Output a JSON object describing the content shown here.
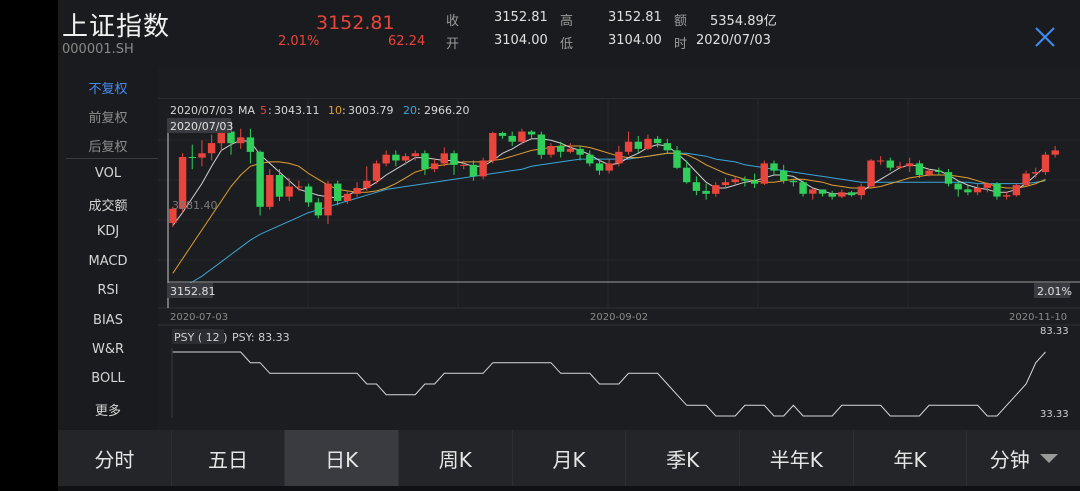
{
  "header": {
    "title": "上证指数",
    "code": "000001.SH",
    "price": "3152.81",
    "change_pct": "2.01%",
    "change": "62.24",
    "quotes": [
      {
        "label": "收",
        "value": "3152.81"
      },
      {
        "label": "高",
        "value": "3152.81"
      },
      {
        "label": "额",
        "value": "5354.89亿"
      },
      {
        "label": "开",
        "value": "3104.00"
      },
      {
        "label": "低",
        "value": "3104.00"
      },
      {
        "label": "时",
        "value": "2020/07/03"
      }
    ]
  },
  "sidebar": {
    "adjust": [
      "不复权",
      "前复权",
      "后复权"
    ],
    "indicators": [
      "VOL",
      "成交额",
      "KDJ",
      "MACD",
      "RSI",
      "BIAS",
      "W&R",
      "BOLL",
      "更多"
    ]
  },
  "chart_data": {
    "type": "candlestick",
    "ma_header": {
      "date": "2020/07/03",
      "label": "MA",
      "ma5_label": "5",
      "ma5": "3043.11",
      "ma10_label": "10",
      "ma10": "3003.79",
      "ma20_label": "20",
      "ma20": "2966.20"
    },
    "crosshair_date": "2020/07/03",
    "crosshair_price": "3152.81",
    "crosshair_pct": "2.01%",
    "mid_price_label": "3181.40",
    "x_labels": [
      "2020-07-03",
      "2020-09-02",
      "2020-11-10"
    ],
    "y_range": [
      2900,
      3460
    ],
    "colors": {
      "up": "#e8453c",
      "down": "#2fcf5a",
      "ma5": "#d0d0d0",
      "ma10": "#e0a030",
      "ma20": "#3aa7d8"
    },
    "candles": [
      [
        3104,
        3153,
        3090,
        3160
      ],
      [
        3153,
        3332,
        3140,
        3345
      ],
      [
        3332,
        3330,
        3290,
        3375
      ],
      [
        3330,
        3345,
        3300,
        3390
      ],
      [
        3345,
        3380,
        3320,
        3410
      ],
      [
        3380,
        3420,
        3350,
        3440
      ],
      [
        3420,
        3380,
        3340,
        3455
      ],
      [
        3380,
        3400,
        3360,
        3430
      ],
      [
        3400,
        3350,
        3310,
        3430
      ],
      [
        3350,
        3160,
        3130,
        3355
      ],
      [
        3160,
        3270,
        3150,
        3290
      ],
      [
        3270,
        3195,
        3180,
        3290
      ],
      [
        3195,
        3230,
        3180,
        3260
      ],
      [
        3230,
        3230,
        3215,
        3250
      ],
      [
        3230,
        3175,
        3160,
        3240
      ],
      [
        3175,
        3130,
        3120,
        3190
      ],
      [
        3130,
        3240,
        3100,
        3250
      ],
      [
        3240,
        3180,
        3165,
        3250
      ],
      [
        3180,
        3205,
        3170,
        3215
      ],
      [
        3205,
        3225,
        3195,
        3245
      ],
      [
        3225,
        3250,
        3215,
        3300
      ],
      [
        3250,
        3310,
        3240,
        3320
      ],
      [
        3310,
        3340,
        3300,
        3355
      ],
      [
        3340,
        3320,
        3300,
        3355
      ],
      [
        3320,
        3335,
        3305,
        3345
      ],
      [
        3335,
        3345,
        3320,
        3355
      ],
      [
        3345,
        3290,
        3270,
        3355
      ],
      [
        3290,
        3310,
        3280,
        3325
      ],
      [
        3310,
        3345,
        3300,
        3365
      ],
      [
        3345,
        3305,
        3270,
        3355
      ],
      [
        3305,
        3305,
        3290,
        3320
      ],
      [
        3305,
        3265,
        3250,
        3320
      ],
      [
        3265,
        3320,
        3255,
        3330
      ],
      [
        3320,
        3415,
        3310,
        3420
      ],
      [
        3415,
        3405,
        3395,
        3420
      ],
      [
        3405,
        3385,
        3370,
        3420
      ],
      [
        3385,
        3420,
        3375,
        3430
      ],
      [
        3420,
        3410,
        3395,
        3425
      ],
      [
        3410,
        3340,
        3325,
        3420
      ],
      [
        3340,
        3370,
        3330,
        3380
      ],
      [
        3370,
        3350,
        3330,
        3385
      ],
      [
        3350,
        3360,
        3345,
        3380
      ],
      [
        3360,
        3340,
        3320,
        3370
      ],
      [
        3340,
        3310,
        3300,
        3355
      ],
      [
        3310,
        3285,
        3270,
        3325
      ],
      [
        3285,
        3310,
        3275,
        3325
      ],
      [
        3310,
        3350,
        3300,
        3370
      ],
      [
        3350,
        3385,
        3340,
        3420
      ],
      [
        3385,
        3360,
        3345,
        3405
      ],
      [
        3360,
        3395,
        3355,
        3410
      ],
      [
        3395,
        3380,
        3365,
        3405
      ],
      [
        3380,
        3355,
        3345,
        3395
      ],
      [
        3355,
        3295,
        3290,
        3370
      ],
      [
        3295,
        3245,
        3240,
        3320
      ],
      [
        3245,
        3215,
        3200,
        3265
      ],
      [
        3215,
        3205,
        3185,
        3240
      ],
      [
        3205,
        3235,
        3195,
        3245
      ],
      [
        3235,
        3245,
        3225,
        3260
      ],
      [
        3245,
        3255,
        3235,
        3265
      ],
      [
        3255,
        3250,
        3230,
        3265
      ],
      [
        3250,
        3240,
        3225,
        3275
      ],
      [
        3240,
        3310,
        3235,
        3320
      ],
      [
        3310,
        3285,
        3270,
        3320
      ],
      [
        3285,
        3250,
        3240,
        3305
      ],
      [
        3250,
        3245,
        3230,
        3255
      ],
      [
        3245,
        3205,
        3195,
        3250
      ],
      [
        3205,
        3220,
        3185,
        3225
      ],
      [
        3220,
        3205,
        3195,
        3220
      ],
      [
        3205,
        3195,
        3185,
        3215
      ],
      [
        3195,
        3210,
        3190,
        3220
      ],
      [
        3210,
        3200,
        3195,
        3215
      ],
      [
        3200,
        3230,
        3185,
        3240
      ],
      [
        3230,
        3320,
        3225,
        3325
      ],
      [
        3320,
        3320,
        3305,
        3335
      ],
      [
        3320,
        3295,
        3285,
        3330
      ],
      [
        3295,
        3300,
        3290,
        3315
      ],
      [
        3300,
        3310,
        3280,
        3330
      ],
      [
        3310,
        3270,
        3260,
        3320
      ],
      [
        3270,
        3285,
        3265,
        3290
      ],
      [
        3285,
        3280,
        3270,
        3295
      ],
      [
        3280,
        3240,
        3230,
        3290
      ],
      [
        3240,
        3220,
        3195,
        3250
      ],
      [
        3220,
        3210,
        3200,
        3235
      ],
      [
        3210,
        3225,
        3200,
        3240
      ],
      [
        3225,
        3240,
        3210,
        3245
      ],
      [
        3240,
        3195,
        3185,
        3245
      ],
      [
        3195,
        3200,
        3185,
        3210
      ],
      [
        3200,
        3235,
        3195,
        3240
      ],
      [
        3235,
        3275,
        3230,
        3285
      ],
      [
        3275,
        3280,
        3260,
        3295
      ],
      [
        3280,
        3340,
        3270,
        3350
      ],
      [
        3340,
        3355,
        3330,
        3370
      ]
    ],
    "ma5": [
      3095,
      3140,
      3190,
      3240,
      3300,
      3355,
      3375,
      3390,
      3385,
      3340,
      3310,
      3280,
      3250,
      3220,
      3210,
      3200,
      3195,
      3190,
      3200,
      3215,
      3225,
      3245,
      3270,
      3290,
      3310,
      3330,
      3330,
      3325,
      3320,
      3320,
      3310,
      3300,
      3300,
      3320,
      3345,
      3360,
      3380,
      3395,
      3395,
      3390,
      3380,
      3365,
      3355,
      3340,
      3320,
      3305,
      3310,
      3330,
      3345,
      3365,
      3375,
      3370,
      3345,
      3315,
      3280,
      3245,
      3225,
      3225,
      3235,
      3245,
      3250,
      3260,
      3270,
      3270,
      3265,
      3245,
      3225,
      3215,
      3205,
      3205,
      3205,
      3210,
      3235,
      3255,
      3275,
      3295,
      3305,
      3300,
      3290,
      3285,
      3270,
      3250,
      3235,
      3225,
      3220,
      3210,
      3210,
      3220,
      3240,
      3270,
      3300
    ],
    "ma10": [
      2930,
      2980,
      3030,
      3080,
      3130,
      3180,
      3230,
      3270,
      3300,
      3310,
      3315,
      3315,
      3310,
      3300,
      3275,
      3255,
      3235,
      3220,
      3215,
      3210,
      3210,
      3215,
      3225,
      3240,
      3260,
      3280,
      3290,
      3300,
      3305,
      3310,
      3315,
      3315,
      3315,
      3320,
      3325,
      3335,
      3345,
      3355,
      3360,
      3365,
      3370,
      3370,
      3370,
      3365,
      3355,
      3345,
      3335,
      3330,
      3330,
      3335,
      3340,
      3345,
      3345,
      3340,
      3325,
      3305,
      3290,
      3275,
      3265,
      3255,
      3250,
      3245,
      3245,
      3250,
      3255,
      3255,
      3250,
      3245,
      3235,
      3230,
      3225,
      3225,
      3225,
      3230,
      3240,
      3250,
      3260,
      3265,
      3270,
      3270,
      3270,
      3265,
      3260,
      3250,
      3240,
      3230,
      3225,
      3225,
      3230,
      3240,
      3255
    ],
    "ma20": [
      2860,
      2880,
      2900,
      2920,
      2945,
      2970,
      2995,
      3020,
      3045,
      3065,
      3080,
      3095,
      3110,
      3125,
      3140,
      3150,
      3160,
      3170,
      3180,
      3190,
      3200,
      3210,
      3220,
      3225,
      3230,
      3235,
      3240,
      3245,
      3250,
      3255,
      3260,
      3265,
      3270,
      3275,
      3280,
      3285,
      3290,
      3300,
      3305,
      3310,
      3315,
      3320,
      3325,
      3325,
      3325,
      3325,
      3325,
      3325,
      3330,
      3335,
      3340,
      3345,
      3345,
      3345,
      3340,
      3335,
      3325,
      3320,
      3315,
      3305,
      3300,
      3295,
      3290,
      3285,
      3280,
      3275,
      3270,
      3265,
      3260,
      3255,
      3250,
      3245,
      3245,
      3245,
      3245,
      3245,
      3245,
      3245,
      3245,
      3245,
      3245,
      3245,
      3245,
      3240,
      3240,
      3240,
      3240,
      3240,
      3240,
      3245,
      3250
    ],
    "psy": {
      "label": "PSY ( 12 )",
      "value_label": "PSY: 83.33",
      "max_label": "83.33",
      "min_label": "33.33",
      "range": [
        33.33,
        83.33
      ],
      "values": [
        83.33,
        83.33,
        83.33,
        83.33,
        83.33,
        83.33,
        83.33,
        83.33,
        75,
        75,
        66.67,
        66.67,
        66.67,
        66.67,
        66.67,
        66.67,
        66.67,
        66.67,
        66.67,
        66.67,
        58.33,
        58.33,
        50,
        50,
        50,
        50,
        58.33,
        58.33,
        66.67,
        66.67,
        66.67,
        66.67,
        66.67,
        75,
        75,
        75,
        75,
        75,
        75,
        75,
        66.67,
        66.67,
        66.67,
        66.67,
        58.33,
        58.33,
        58.33,
        66.67,
        66.67,
        66.67,
        66.67,
        58.33,
        50,
        41.67,
        41.67,
        41.67,
        33.33,
        33.33,
        33.33,
        41.67,
        41.67,
        41.67,
        33.33,
        33.33,
        41.67,
        33.33,
        33.33,
        33.33,
        33.33,
        41.67,
        41.67,
        41.67,
        41.67,
        41.67,
        33.33,
        33.33,
        33.33,
        33.33,
        41.67,
        41.67,
        41.67,
        41.67,
        41.67,
        41.67,
        33.33,
        33.33,
        41.67,
        50,
        58.33,
        75,
        83.33
      ]
    }
  },
  "tabs": [
    "分时",
    "五日",
    "日K",
    "周K",
    "月K",
    "季K",
    "半年K",
    "年K",
    "分钟"
  ],
  "active_tab": 2,
  "active_adjust": 0
}
